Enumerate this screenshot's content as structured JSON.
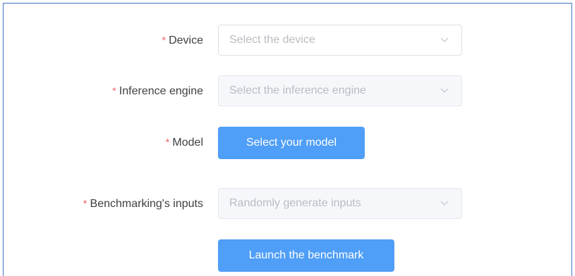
{
  "form": {
    "required_mark": "*",
    "device": {
      "label": "Device",
      "placeholder": "Select the device",
      "icon": "chevron-down-icon"
    },
    "inference_engine": {
      "label": "Inference engine",
      "placeholder": "Select the inference engine",
      "icon": "chevron-down-icon"
    },
    "model": {
      "label": "Model",
      "button_label": "Select your model"
    },
    "benchmark_inputs": {
      "label": "Benchmarking's inputs",
      "value": "Randomly generate inputs",
      "icon": "chevron-down-icon"
    },
    "launch_button_label": "Launch the benchmark"
  },
  "colors": {
    "accent": "#4f9ef8",
    "required": "#f56c6c",
    "border": "#4472c4"
  }
}
